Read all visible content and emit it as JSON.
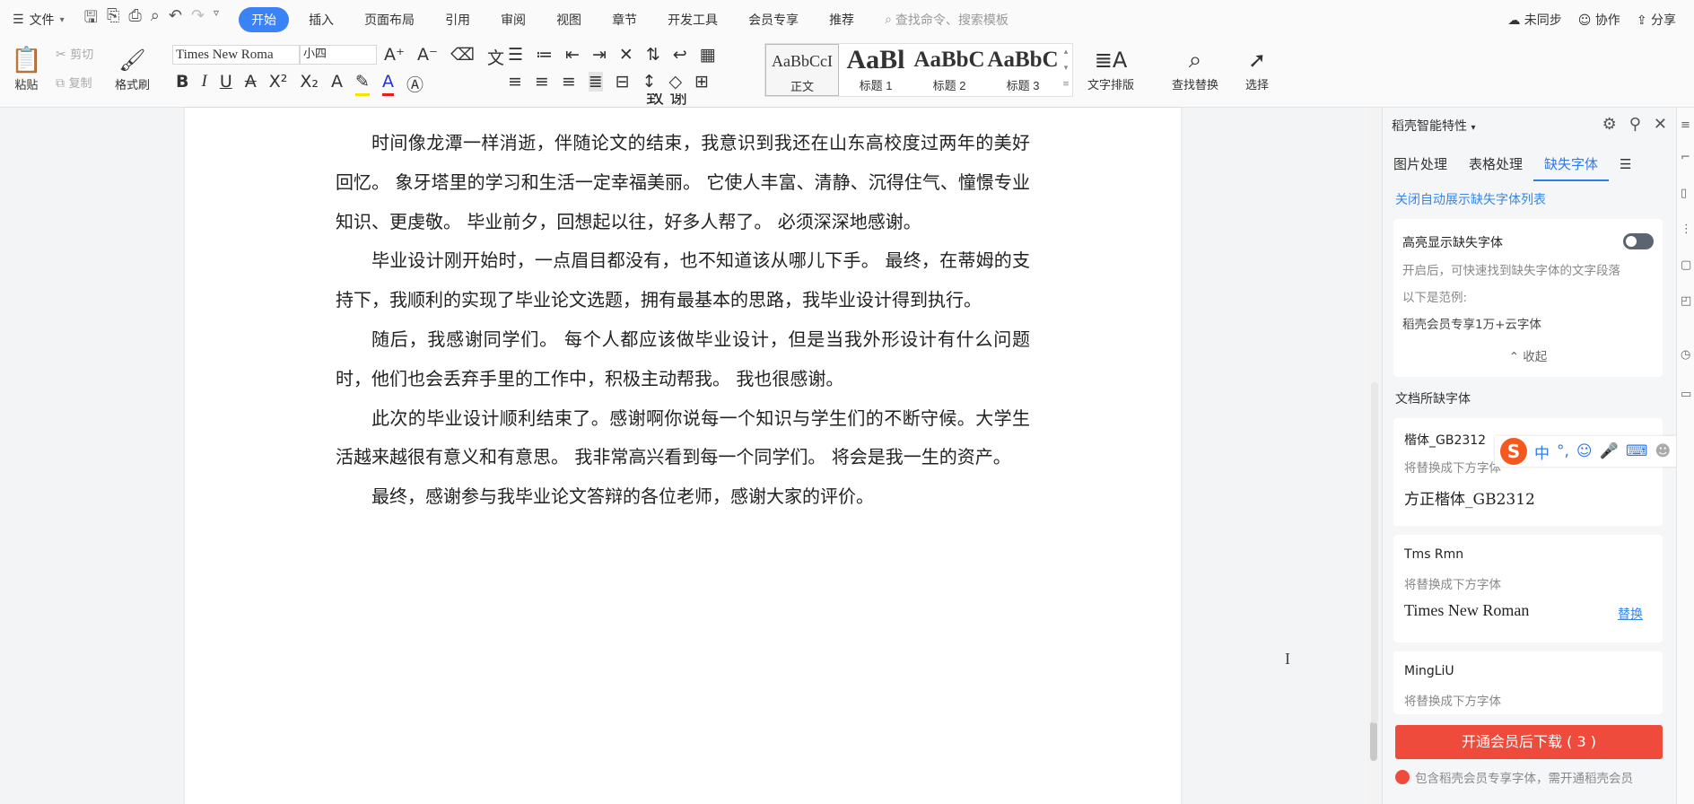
{
  "menubar": {
    "file_label": "文件",
    "tabs": [
      "开始",
      "插入",
      "页面布局",
      "引用",
      "审阅",
      "视图",
      "章节",
      "开发工具",
      "会员专享",
      "推荐"
    ],
    "search_placeholder": "查找命令、搜索模板",
    "sync": "未同步",
    "collab": "协作",
    "share": "分享"
  },
  "ribbon": {
    "paste": "粘贴",
    "cut": "剪切",
    "copy": "复制",
    "format_painter": "格式刷",
    "font_name": "Times New Roma",
    "font_size": "小四",
    "styles": [
      {
        "preview": "AaBbCcI",
        "name": "正文"
      },
      {
        "preview": "AaBl",
        "name": "标题 1"
      },
      {
        "preview": "AaBbC",
        "name": "标题 2"
      },
      {
        "preview": "AaBbC",
        "name": "标题 3"
      }
    ],
    "text_layout": "文字排版",
    "find_replace": "查找替换",
    "select": "选择"
  },
  "document": {
    "heading_partial": "致  谢",
    "paragraphs": [
      "时间像龙潭一样消逝，伴随论文的结束，我意识到我还在山东高校度过两年的美好回忆。 象牙塔里的学习和生活一定幸福美丽。 它使人丰富、清静、沉得住气、憧憬专业知识、更虔敬。 毕业前夕，回想起以往，好多人帮了。 必须深深地感谢。",
      "毕业设计刚开始时，一点眉目都没有，也不知道该从哪儿下手。 最终，在蒂姆的支持下，我顺利的实现了毕业论文选题，拥有最基本的思路，我毕业设计得到执行。",
      "随后，我感谢同学们。 每个人都应该做毕业设计，但是当我外形设计有什么问题时，他们也会丢弃手里的工作中，积极主动帮我。 我也很感谢。",
      "此次的毕业设计顺利结束了。感谢啊你说每一个知识与学生们的不断守候。大学生活越来越很有意义和有意思。 我非常高兴看到每一个同学们。 将会是我一生的资产。",
      "最终，感谢参与我毕业论文答辩的各位老师，感谢大家的评价。"
    ]
  },
  "panel": {
    "title": "稻壳智能特性",
    "tabs": [
      "图片处理",
      "表格处理",
      "缺失字体"
    ],
    "close_auto_link": "关闭自动展示缺失字体列表",
    "highlight": {
      "title": "高亮显示缺失字体",
      "desc": "开启后，可快速找到缺失字体的文字段落",
      "example_label": "以下是范例:",
      "example": "稻壳会员专享1万+云字体",
      "collapse": "收起"
    },
    "section_title": "文档所缺字体",
    "fonts": [
      {
        "missing": "楷体_GB2312",
        "hint": "将替换成下方字体",
        "replacement": "方正楷体_GB2312",
        "action": ""
      },
      {
        "missing": "Tms Rmn",
        "hint": "将替换成下方字体",
        "replacement": "Times New Roman",
        "action": "替换"
      },
      {
        "missing": "MingLiU",
        "hint": "将替换成下方字体",
        "replacement": "",
        "action": ""
      }
    ],
    "cta": "开通会员后下载 ( 3 )",
    "note": "包含稻壳会员专享字体，需开通稻壳会员"
  },
  "ime": {
    "lang": "中",
    "punct": "°,"
  }
}
